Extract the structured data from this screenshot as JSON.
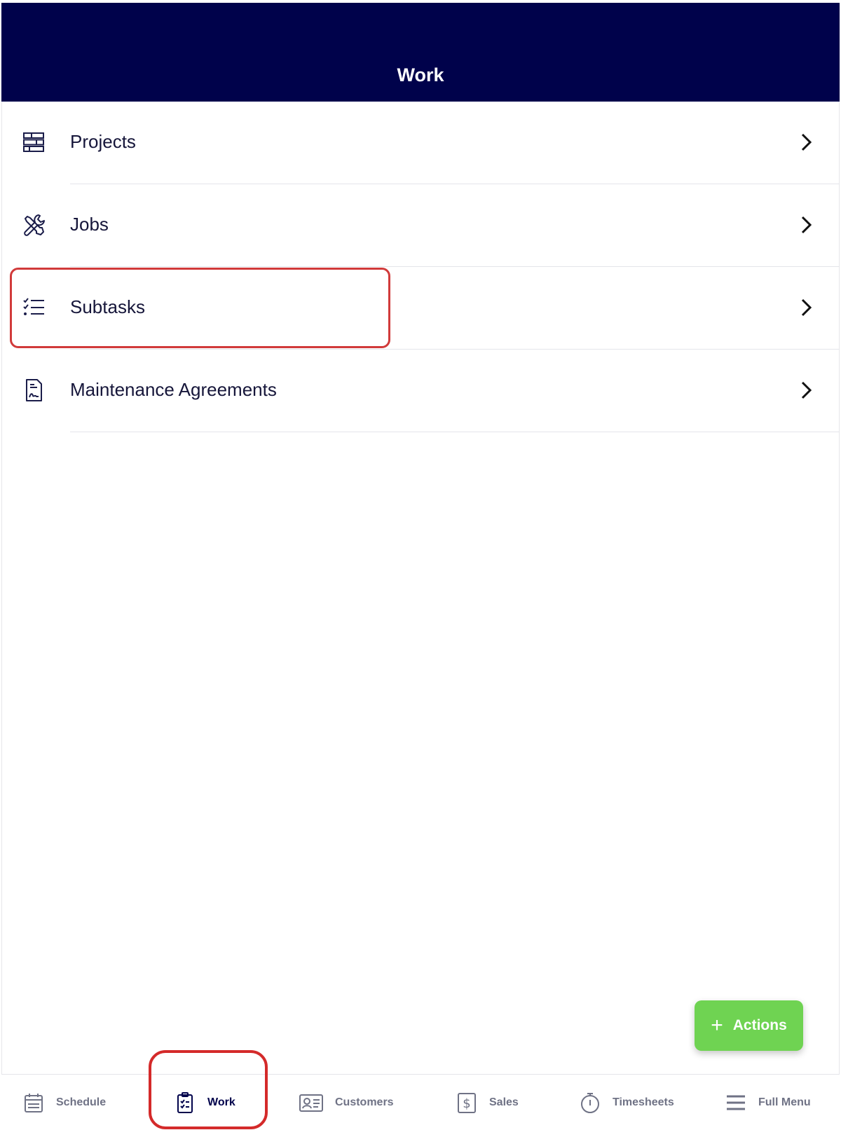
{
  "header": {
    "title": "Work"
  },
  "menu": {
    "items": [
      {
        "label": "Projects",
        "icon": "projects-icon"
      },
      {
        "label": "Jobs",
        "icon": "tools-icon"
      },
      {
        "label": "Subtasks",
        "icon": "checklist-icon"
      },
      {
        "label": "Maintenance Agreements",
        "icon": "agreement-document-icon"
      }
    ]
  },
  "fab": {
    "label": "Actions",
    "icon": "plus-icon"
  },
  "bottom_nav": {
    "items": [
      {
        "label": "Schedule",
        "icon": "calendar-icon"
      },
      {
        "label": "Work",
        "icon": "clipboard-checklist-icon",
        "active": true
      },
      {
        "label": "Customers",
        "icon": "id-card-icon"
      },
      {
        "label": "Sales",
        "icon": "dollar-icon"
      },
      {
        "label": "Timesheets",
        "icon": "stopwatch-icon"
      },
      {
        "label": "Full Menu",
        "icon": "hamburger-menu-icon"
      }
    ]
  },
  "colors": {
    "header_bg": "#00024b",
    "fab_bg": "#6fd352",
    "highlight": "#d13a3a",
    "nav_inactive": "#6f7285",
    "nav_active": "#00024b"
  }
}
